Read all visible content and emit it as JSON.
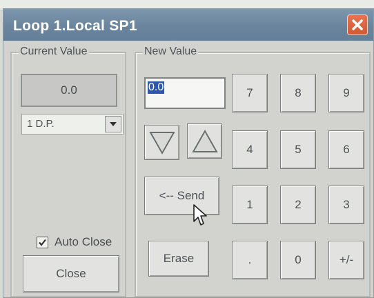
{
  "window": {
    "title": "Loop 1.Local SP1"
  },
  "current_value": {
    "legend": "Current Value",
    "value": "0.0",
    "decimal_select": "1 D.P."
  },
  "new_value": {
    "legend": "New Value",
    "input_value": "0.0"
  },
  "keypad": {
    "k7": "7",
    "k8": "8",
    "k9": "9",
    "k4": "4",
    "k5": "5",
    "k6": "6",
    "k1": "1",
    "k2": "2",
    "k3": "3",
    "dot": ".",
    "k0": "0",
    "sign": "+/-"
  },
  "buttons": {
    "send": "<-- Send",
    "erase": "Erase",
    "close": "Close"
  },
  "auto_close": {
    "label": "Auto Close",
    "checked": true
  },
  "colors": {
    "titlebar": "#6a859d",
    "close_button": "#d25a35",
    "selection": "#2d57ad"
  }
}
